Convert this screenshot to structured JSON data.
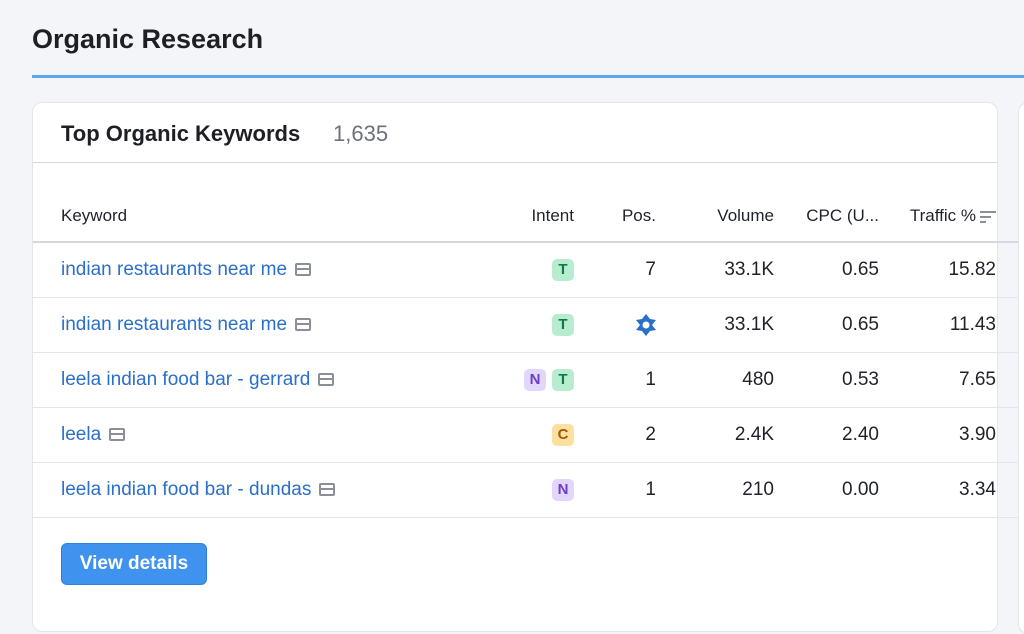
{
  "page": {
    "title": "Organic Research"
  },
  "card": {
    "title": "Top Organic Keywords",
    "count": "1,635",
    "columns": {
      "keyword": "Keyword",
      "intent": "Intent",
      "position": "Pos.",
      "volume": "Volume",
      "cpc": "CPC (U...",
      "traffic": "Traffic %"
    },
    "rows": [
      {
        "keyword": "indian restaurants near me",
        "intents": [
          "T"
        ],
        "position": "7",
        "volume": "33.1K",
        "cpc": "0.65",
        "traffic": "15.82"
      },
      {
        "keyword": "indian restaurants near me",
        "intents": [
          "T"
        ],
        "position": "",
        "position_icon": "serp-feature-icon",
        "volume": "33.1K",
        "cpc": "0.65",
        "traffic": "11.43"
      },
      {
        "keyword": "leela indian food bar - gerrard",
        "intents": [
          "N",
          "T"
        ],
        "position": "1",
        "volume": "480",
        "cpc": "0.53",
        "traffic": "7.65"
      },
      {
        "keyword": "leela",
        "intents": [
          "C"
        ],
        "position": "2",
        "volume": "2.4K",
        "cpc": "2.40",
        "traffic": "3.90"
      },
      {
        "keyword": "leela indian food bar - dundas",
        "intents": [
          "N"
        ],
        "position": "1",
        "volume": "210",
        "cpc": "0.00",
        "traffic": "3.34"
      }
    ],
    "view_details_label": "View details"
  },
  "colors": {
    "accent": "#3f93ef",
    "link": "#2a6fc9",
    "header_underline": "#5ca6ea",
    "intent_transactional": "#b7ecd1",
    "intent_navigational": "#e3d6fb",
    "intent_commercial": "#fde0a0"
  },
  "icons": {
    "serp_snapshot": "serp-snapshot-icon",
    "sort": "sort-descending-icon",
    "serp_feature": "serp-feature-icon"
  }
}
